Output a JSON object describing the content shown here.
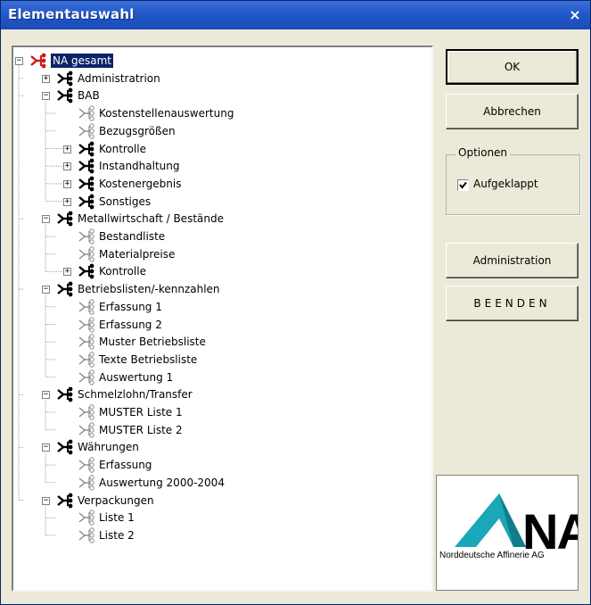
{
  "window": {
    "title": "Elementauswahl",
    "close_glyph": "×"
  },
  "tree": {
    "root": "NA gesamt",
    "items": [
      {
        "label": "Administratrion",
        "level": 1,
        "type": "branch",
        "expander": "+"
      },
      {
        "label": "BAB",
        "level": 1,
        "type": "branch",
        "expander": "−"
      },
      {
        "label": "Kostenstellenauswertung",
        "level": 2,
        "type": "leaf"
      },
      {
        "label": "Bezugsgrößen",
        "level": 2,
        "type": "leaf"
      },
      {
        "label": "Kontrolle",
        "level": 2,
        "type": "branch",
        "expander": "+"
      },
      {
        "label": "Instandhaltung",
        "level": 2,
        "type": "branch",
        "expander": "+"
      },
      {
        "label": "Kostenergebnis",
        "level": 2,
        "type": "branch",
        "expander": "+"
      },
      {
        "label": "Sonstiges",
        "level": 2,
        "type": "branch",
        "expander": "+"
      },
      {
        "label": "Metallwirtschaft / Bestände",
        "level": 1,
        "type": "branch",
        "expander": "−"
      },
      {
        "label": "Bestandliste",
        "level": 2,
        "type": "leaf"
      },
      {
        "label": "Materialpreise",
        "level": 2,
        "type": "leaf"
      },
      {
        "label": "Kontrolle",
        "level": 2,
        "type": "branch",
        "expander": "+"
      },
      {
        "label": "Betriebslisten/-kennzahlen",
        "level": 1,
        "type": "branch",
        "expander": "−"
      },
      {
        "label": "Erfassung 1",
        "level": 2,
        "type": "leaf"
      },
      {
        "label": "Erfassung 2",
        "level": 2,
        "type": "leaf"
      },
      {
        "label": "Muster Betriebsliste",
        "level": 2,
        "type": "leaf"
      },
      {
        "label": "Texte Betriebsliste",
        "level": 2,
        "type": "leaf"
      },
      {
        "label": "Auswertung 1",
        "level": 2,
        "type": "leaf"
      },
      {
        "label": "Schmelzlohn/Transfer",
        "level": 1,
        "type": "branch",
        "expander": "−"
      },
      {
        "label": "MUSTER Liste 1",
        "level": 2,
        "type": "leaf"
      },
      {
        "label": "MUSTER Liste 2",
        "level": 2,
        "type": "leaf"
      },
      {
        "label": "Währungen",
        "level": 1,
        "type": "branch",
        "expander": "−"
      },
      {
        "label": "Erfassung",
        "level": 2,
        "type": "leaf"
      },
      {
        "label": "Auswertung 2000-2004",
        "level": 2,
        "type": "leaf"
      },
      {
        "label": "Verpackungen",
        "level": 1,
        "type": "branch",
        "expander": "−"
      },
      {
        "label": "Liste 1",
        "level": 2,
        "type": "leaf"
      },
      {
        "label": "Liste 2",
        "level": 2,
        "type": "leaf"
      }
    ]
  },
  "buttons": {
    "ok": "OK",
    "cancel": "Abbrechen",
    "administration": "Administration",
    "quit": "BEENDEN"
  },
  "options": {
    "group_title": "Optionen",
    "expanded_label": "Aufgeklappt",
    "expanded_checked": true
  },
  "logo": {
    "mark": "NA",
    "company": "Norddeutsche Affinerie AG",
    "colors": {
      "triangle": "#1aa7b8",
      "triangle_dark": "#127d8a"
    }
  }
}
